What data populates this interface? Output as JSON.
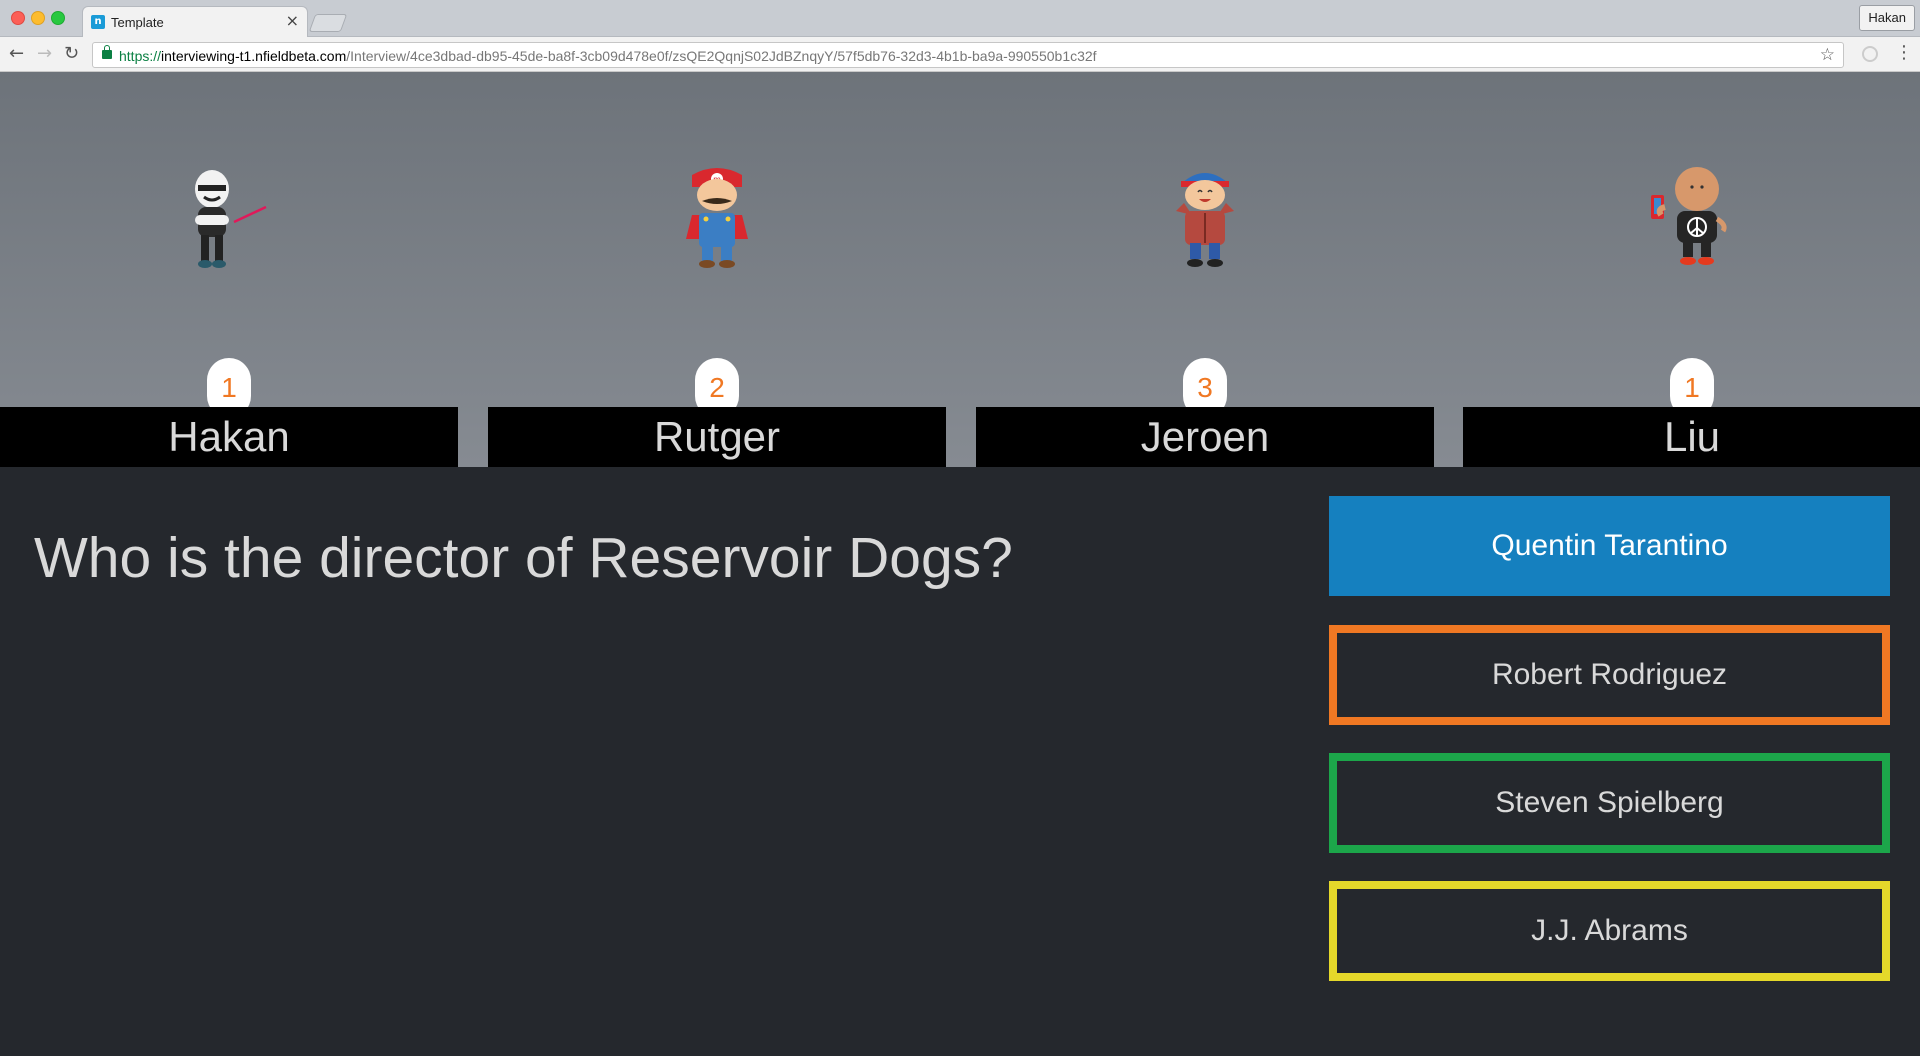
{
  "browser": {
    "tab_title": "Template",
    "tab_favicon_letter": "n",
    "tab_close": "×",
    "profile_name": "Hakan",
    "url_scheme": "https://",
    "url_host": "interviewing-t1.nfieldbeta.com",
    "url_path": "/Interview/4ce3dbad-db95-45de-ba8f-3cb09d478e0f/zsQE2QqnjS02JdBZnqyY/57f5db76-32d3-4b1b-ba9a-990550b1c32f",
    "back_icon": "←",
    "forward_icon": "→",
    "reload_icon": "↻",
    "star_icon": "☆",
    "menu_icon": "⋮"
  },
  "players": [
    {
      "name": "Hakan",
      "score": "1",
      "avatar": "stormtrooper-avatar"
    },
    {
      "name": "Rutger",
      "score": "2",
      "avatar": "plumber-avatar"
    },
    {
      "name": "Jeroen",
      "score": "3",
      "avatar": "kid-beanie-avatar"
    },
    {
      "name": "Liu",
      "score": "1",
      "avatar": "phone-peace-avatar"
    }
  ],
  "question": "Who is the director of Reservoir Dogs?",
  "answers": [
    {
      "label": "Quentin Tarantino",
      "color": "#1580bf"
    },
    {
      "label": "Robert Rodriguez",
      "color": "#f07823"
    },
    {
      "label": "Steven Spielberg",
      "color": "#1ca64a"
    },
    {
      "label": "J.J. Abrams",
      "color": "#e5d82a"
    }
  ]
}
